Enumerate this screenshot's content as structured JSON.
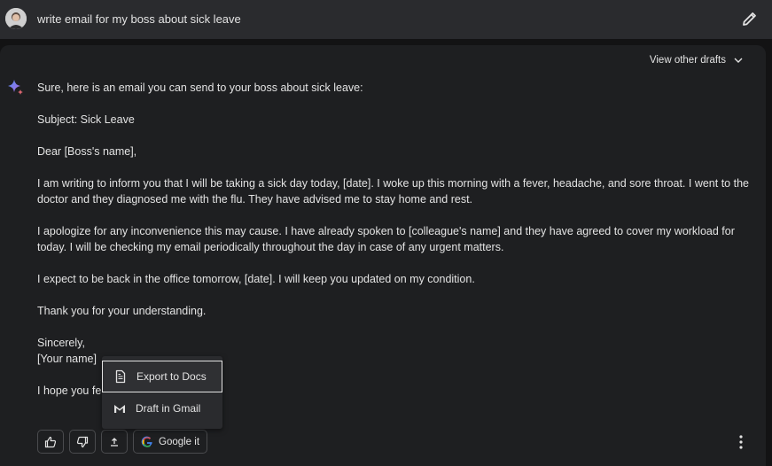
{
  "prompt": {
    "text": "write email for my boss about sick leave"
  },
  "response": {
    "view_drafts_label": "View other drafts",
    "paragraphs": [
      "Sure, here is an email you can send to your boss about sick leave:",
      "Subject: Sick Leave",
      "Dear [Boss's name],",
      "I am writing to inform you that I will be taking a sick day today, [date]. I woke up this morning with a fever, headache, and sore throat. I went to the doctor and they diagnosed me with the flu. They have advised me to stay home and rest.",
      "I apologize for any inconvenience this may cause. I have already spoken to [colleague's name] and they have agreed to cover my workload for today. I will be checking my email periodically throughout the day in case of any urgent matters.",
      "I expect to be back in the office tomorrow, [date]. I will keep you updated on my condition.",
      "Thank you for your understanding.",
      "Sincerely,",
      "[Your name]",
      "I hope you fe"
    ]
  },
  "actions": {
    "google_label": "Google it"
  },
  "export_menu": {
    "items": [
      "Export to Docs",
      "Draft in Gmail"
    ]
  },
  "colors": {
    "background": "#131314",
    "card": "#1e1f21",
    "prompt_bar": "#2a2b2e",
    "text": "#e3e3e3"
  }
}
